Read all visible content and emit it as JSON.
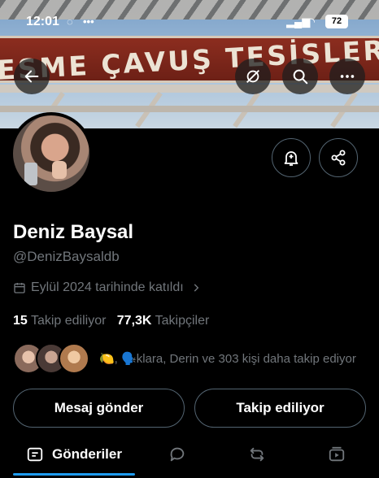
{
  "status_bar": {
    "time": "12:01",
    "battery": "72"
  },
  "banner": {
    "sign_text": "ESME ÇAVUŞ TESİSLERİ"
  },
  "profile": {
    "name": "Deniz Baysal",
    "handle": "@DenizBaysaldb",
    "joined": "Eylül 2024 tarihinde katıldı",
    "following_count": "15",
    "following_label": "Takip ediliyor",
    "followers_count": "77,3K",
    "followers_label": "Takipçiler",
    "followed_by": "🍋, 🗣️klara, Derin ve 303 kişi daha takip ediyor"
  },
  "actions": {
    "message": "Mesaj gönder",
    "following": "Takip ediliyor"
  },
  "tabs": [
    {
      "label": "Gönderiler",
      "active": true
    }
  ],
  "icons": [
    "back-arrow-icon",
    "translate-off-icon",
    "search-icon",
    "more-icon",
    "notification-bell-add-icon",
    "share-icon",
    "calendar-icon",
    "chevron-right-icon",
    "posts-icon",
    "replies-icon",
    "reposts-icon",
    "media-icon"
  ],
  "colors": {
    "accent": "#1d9bf0",
    "muted": "#71767b",
    "border": "#536471"
  }
}
